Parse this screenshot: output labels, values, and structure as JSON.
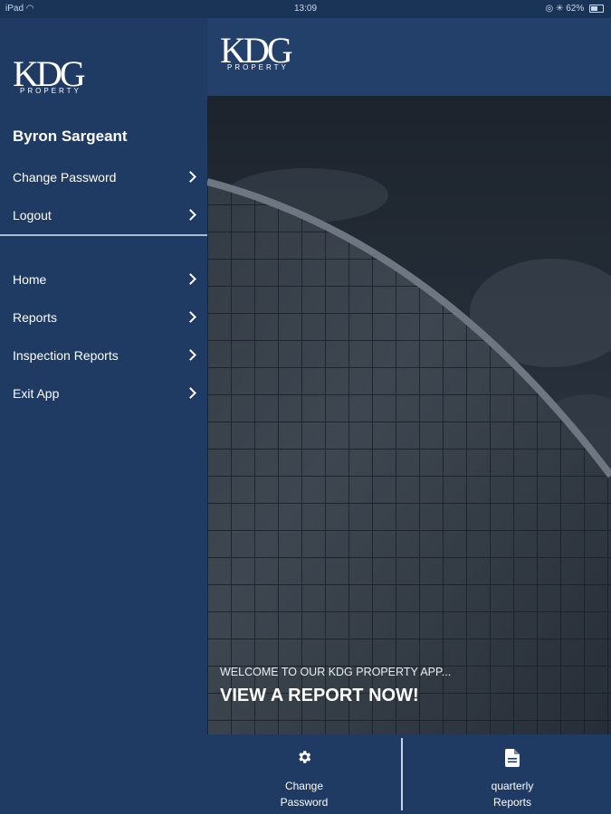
{
  "status_bar": {
    "device": "iPad",
    "time": "13:09",
    "battery": "62%"
  },
  "brand": {
    "logo_text": "KDG",
    "logo_subtext": "PROPERTY"
  },
  "drawer": {
    "user_name": "Byron Sargeant",
    "account_items": [
      {
        "label": "Change Password"
      },
      {
        "label": "Logout"
      }
    ],
    "nav_items": [
      {
        "label": "Home"
      },
      {
        "label": "Reports"
      },
      {
        "label": "Inspection Reports"
      },
      {
        "label": "Exit App"
      }
    ]
  },
  "hero": {
    "welcome": "WELCOME TO OUR KDG PROPERTY APP...",
    "cta": "VIEW A REPORT NOW!"
  },
  "bottom_bar": {
    "items": [
      {
        "line1": "Change",
        "line2": "Password",
        "icon": "gear-icon"
      },
      {
        "line1": "quarterly",
        "line2": "Reports",
        "icon": "document-icon"
      }
    ]
  },
  "colors": {
    "drawer_bg": "#1f3a63",
    "header_bg": "#23406b",
    "divider": "#a9bcd6"
  }
}
